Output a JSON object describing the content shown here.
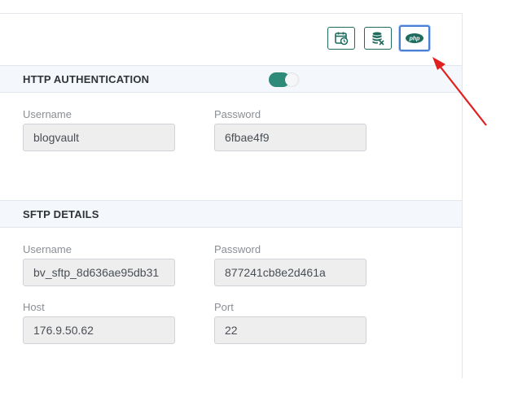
{
  "toolbar": {
    "buttons": [
      {
        "icon": "calendar-clock-icon"
      },
      {
        "icon": "database-remove-icon"
      },
      {
        "icon": "php-icon",
        "label": "php"
      }
    ]
  },
  "http_auth": {
    "title": "HTTP AUTHENTICATION",
    "toggle_on": true,
    "username_label": "Username",
    "username_value": "blogvault",
    "password_label": "Password",
    "password_value": "6fbae4f9"
  },
  "sftp": {
    "title": "SFTP DETAILS",
    "username_label": "Username",
    "username_value": "bv_sftp_8d636ae95db31",
    "password_label": "Password",
    "password_value": "877241cb8e2d461a",
    "host_label": "Host",
    "host_value": "176.9.50.62",
    "port_label": "Port",
    "port_value": "22"
  },
  "colors": {
    "accent": "#1f6b5e",
    "toggle": "#2e8b7a",
    "active_border": "#4a7fd6",
    "arrow": "#e02020"
  }
}
